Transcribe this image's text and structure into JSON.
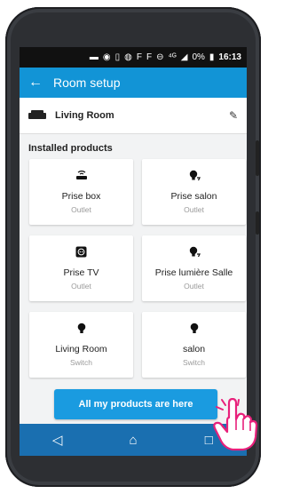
{
  "status_bar": {
    "icons": [
      "message-icon",
      "robot-icon",
      "sim-icon",
      "settings-icon",
      "f-icon",
      "f-icon",
      "minus-icon",
      "4g-icon",
      "signal-icon"
    ],
    "battery": "0%",
    "time": "16:13"
  },
  "app_bar": {
    "title": "Room setup",
    "back_icon": "arrow-left-icon"
  },
  "room": {
    "name": "Living Room",
    "icon": "sofa-icon",
    "edit_icon": "pencil-icon"
  },
  "section_title": "Installed products",
  "products": [
    {
      "name": "Prise box",
      "type": "Outlet",
      "icon": "router-icon"
    },
    {
      "name": "Prise salon",
      "type": "Outlet",
      "icon": "smart-plug-icon"
    },
    {
      "name": "Prise TV",
      "type": "Outlet",
      "icon": "tv-socket-icon"
    },
    {
      "name": "Prise lumière Salle",
      "type": "Outlet",
      "icon": "smart-plug-icon"
    },
    {
      "name": "Living Room",
      "type": "Switch",
      "icon": "bulb-icon"
    },
    {
      "name": "salon",
      "type": "Switch",
      "icon": "bulb-icon"
    }
  ],
  "cta_label": "All my products are here",
  "nav": [
    "back-triangle-icon",
    "home-icon",
    "recents-icon"
  ],
  "colors": {
    "app_bar": "#1294d6",
    "cta": "#1a9be0",
    "nav_bar": "#1a6fb0",
    "hand_outline": "#e8207b"
  }
}
